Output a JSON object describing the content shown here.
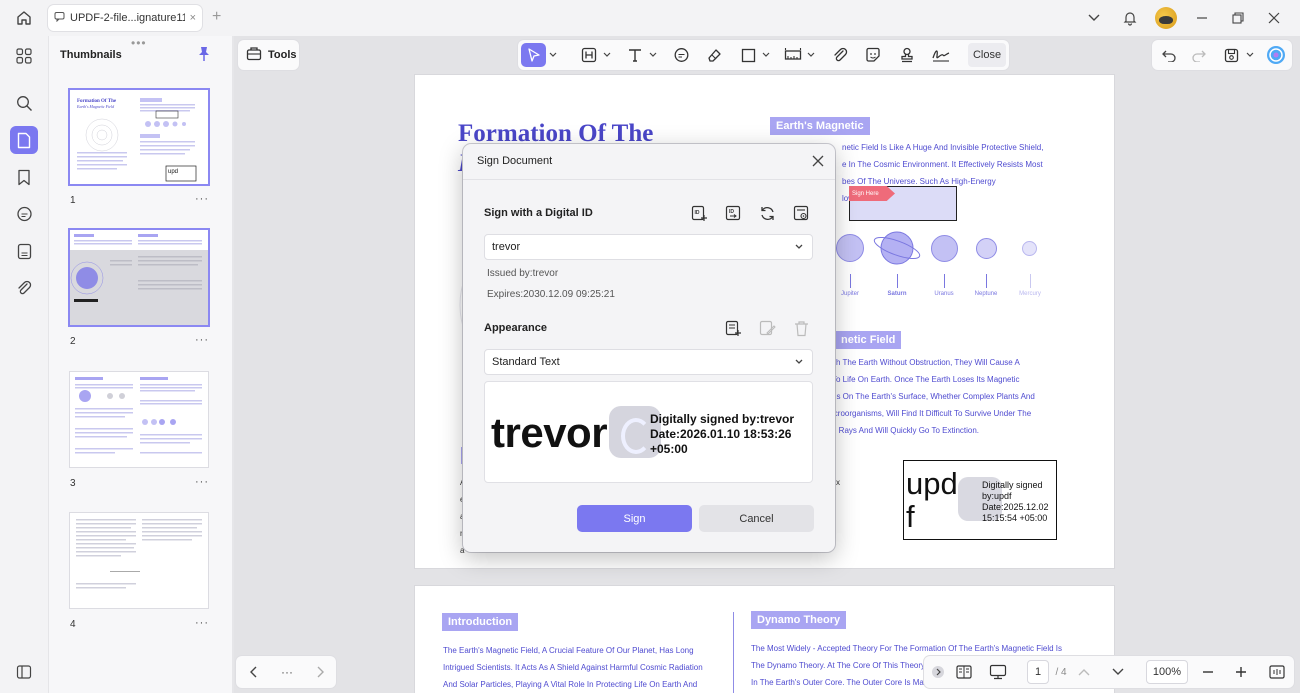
{
  "window": {
    "tab_title": "UPDF-2-file...ignature111",
    "tab_close": "×",
    "new_tab": "+"
  },
  "thumbnails": {
    "title": "Thumbnails",
    "grip": "•••",
    "pages": [
      {
        "number": "1",
        "menu": "···"
      },
      {
        "number": "2",
        "menu": "···"
      },
      {
        "number": "3",
        "menu": "···"
      },
      {
        "number": "4",
        "menu": "···"
      }
    ],
    "thumb1_title": "Formation Of The Earth's Magnetic Field",
    "thumb1_sig": "upd"
  },
  "toolbar": {
    "tools_label": "Tools",
    "close_label": "Close"
  },
  "document": {
    "title_line1": "Formation Of The",
    "title_line2": "E",
    "heading_magnetic": "Earth's Magnetic",
    "heading_field_tail": "netic Field",
    "para1": [
      "netic Field Is Like A Huge And Invisible Protective Shield,",
      "e In The Cosmic Environment. It Effectively Resists Most",
      "bes Of The Universe. Such As High-Energy",
      "low"
    ],
    "para2": [
      "ch The Earth Without Obstruction, They Will Cause A",
      "To Life On Earth. Once The Earth Loses Its Magnetic",
      "es On The Earth's Surface, Whether Complex Plants And",
      "icroorganisms, Will Find It Difficult To Survive Under The",
      "g Rays And Will Quickly Go To Extinction."
    ],
    "sign_here": "Sign Here",
    "planets": [
      "Jupiter",
      "Saturn",
      "Uranus",
      "Neptune",
      "Mercury"
    ],
    "existing_signature": {
      "name_big": "upd f",
      "lines": [
        "Digitally signed",
        "by:updf",
        "Date:2025.12.02",
        "15:15:54 +05:00"
      ]
    },
    "left_fragments": [
      "A",
      "e",
      "a",
      "n",
      "a"
    ],
    "right_fragment": "x",
    "page2": {
      "intro_heading": "Introduction",
      "intro_lines": [
        "The Earth's Magnetic Field, A Crucial Feature Of Our Planet, Has Long",
        "Intrigued Scientists. It Acts As A Shield Against Harmful Cosmic Radiation",
        "And Solar Particles, Playing A Vital Role In Protecting Life On Earth And"
      ],
      "dynamo_heading": "Dynamo Theory",
      "dynamo_lines": [
        "The Most Widely - Accepted Theory For The Formation Of The Earth's Magnetic Field Is",
        "The Dynamo Theory. At The Core Of This Theory",
        "In The Earth's Outer Core. The Outer Core Is Made"
      ]
    }
  },
  "dialog": {
    "title": "Sign Document",
    "digital_id_label": "Sign with a Digital ID",
    "selected_id": "trevor",
    "issued_by": "Issued by:trevor",
    "expires": "Expires:2030.12.09 09:25:21",
    "appearance_label": "Appearance",
    "appearance_value": "Standard Text",
    "preview_name": "trevor",
    "preview_line1": "Digitally signed by:trevor",
    "preview_line2": "Date:2026.01.10 18:53:26",
    "preview_line3": "+05:00",
    "sign_button": "Sign",
    "cancel_button": "Cancel"
  },
  "bottom": {
    "page_dots": "···",
    "current_page": "1",
    "total_pages": "/ 4",
    "zoom": "100%"
  },
  "colors": {
    "accent": "#7b78f0",
    "doc_text": "#4f4bd0",
    "highlight": "#a9a5f2",
    "sign_here": "#ef6b7a"
  }
}
